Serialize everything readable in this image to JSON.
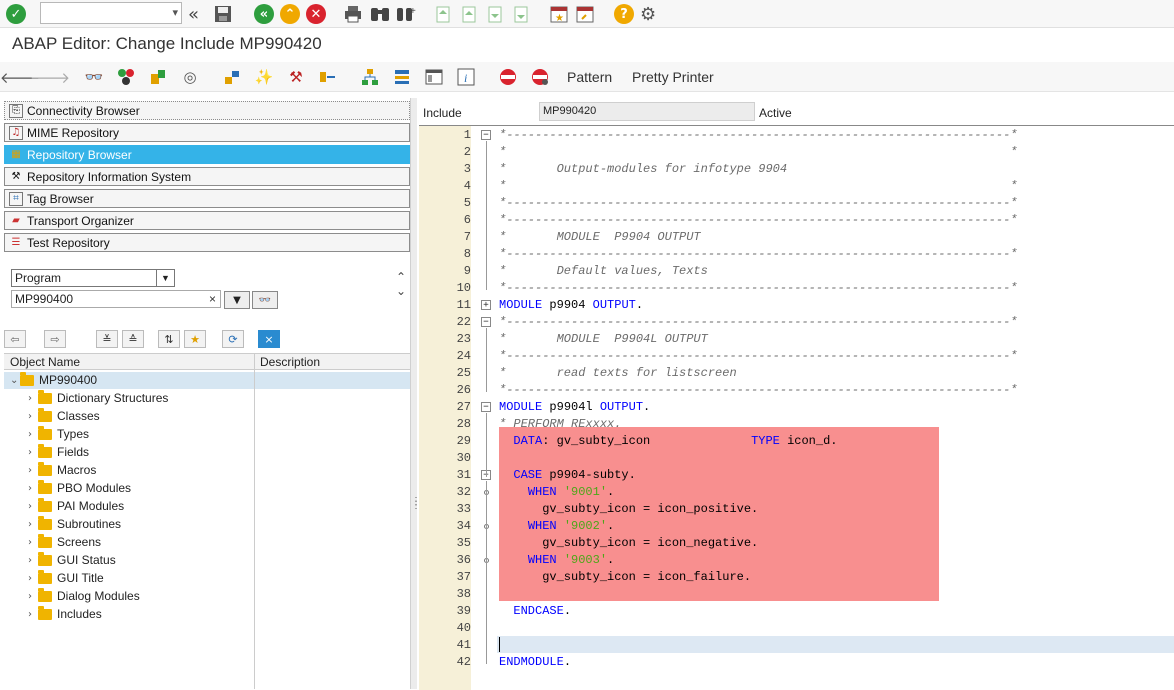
{
  "title": "ABAP Editor: Change Include MP990420",
  "systoolbar": {
    "command_field": "",
    "icons": [
      "check-icon",
      "back-icon",
      "save-icon",
      "enter-icon",
      "exit-icon",
      "cancel-icon",
      "print-icon",
      "find-icon",
      "find-next-icon",
      "first-page-icon",
      "previous-page-icon",
      "next-page-icon",
      "last-page-icon",
      "create-session-icon",
      "shortcut-icon",
      "help-icon",
      "settings-icon"
    ]
  },
  "apptoolbar": {
    "pattern_label": "Pattern",
    "pretty_printer_label": "Pretty Printer"
  },
  "navigator": {
    "buttons": [
      {
        "label": "Connectivity Browser"
      },
      {
        "label": "MIME Repository"
      },
      {
        "label": "Repository Browser"
      },
      {
        "label": "Repository Information System"
      },
      {
        "label": "Tag Browser"
      },
      {
        "label": "Transport Organizer"
      },
      {
        "label": "Test Repository"
      }
    ],
    "object_type": "Program",
    "object_name": "MP990400",
    "columns": {
      "name": "Object Name",
      "description": "Description"
    },
    "root": "MP990400",
    "nodes": [
      "Dictionary Structures",
      "Classes",
      "Types",
      "Fields",
      "Macros",
      "PBO Modules",
      "PAI Modules",
      "Subroutines",
      "Screens",
      "GUI Status",
      "GUI Title",
      "Dialog Modules",
      "Includes"
    ]
  },
  "editor": {
    "include_label": "Include",
    "include_name": "MP990420",
    "status": "Active",
    "lines": [
      {
        "n": "1",
        "t": "*----------------------------------------------------------------------*"
      },
      {
        "n": "2",
        "t": "*                                                                      *"
      },
      {
        "n": "3",
        "t": "*       Output-modules for infotype 9904"
      },
      {
        "n": "4",
        "t": "*                                                                      *"
      },
      {
        "n": "5",
        "t": "*----------------------------------------------------------------------*"
      },
      {
        "n": "6",
        "t": "*----------------------------------------------------------------------*"
      },
      {
        "n": "7",
        "t": "*       MODULE  P9904 OUTPUT"
      },
      {
        "n": "8",
        "t": "*----------------------------------------------------------------------*"
      },
      {
        "n": "9",
        "t": "*       Default values, Texts"
      },
      {
        "n": "10",
        "t": "*----------------------------------------------------------------------*"
      },
      {
        "n": "11",
        "t": "MODULE p9904 OUTPUT."
      },
      {
        "n": "22",
        "t": "*----------------------------------------------------------------------*"
      },
      {
        "n": "23",
        "t": "*       MODULE  P9904L OUTPUT"
      },
      {
        "n": "24",
        "t": "*----------------------------------------------------------------------*"
      },
      {
        "n": "25",
        "t": "*       read texts for listscreen"
      },
      {
        "n": "26",
        "t": "*----------------------------------------------------------------------*"
      },
      {
        "n": "27",
        "t": "MODULE p9904l OUTPUT."
      },
      {
        "n": "28",
        "t": "* PERFORM RExxxx."
      },
      {
        "n": "29",
        "t": "  DATA: gv_subty_icon              TYPE icon_d."
      },
      {
        "n": "30",
        "t": ""
      },
      {
        "n": "31",
        "t": "  CASE p9904-subty."
      },
      {
        "n": "32",
        "t": "    WHEN '9001'."
      },
      {
        "n": "33",
        "t": "      gv_subty_icon = icon_positive."
      },
      {
        "n": "34",
        "t": "    WHEN '9002'."
      },
      {
        "n": "35",
        "t": "      gv_subty_icon = icon_negative."
      },
      {
        "n": "36",
        "t": "    WHEN '9003'."
      },
      {
        "n": "37",
        "t": "      gv_subty_icon = icon_failure."
      },
      {
        "n": "38",
        "t": ""
      },
      {
        "n": "39",
        "t": "  ENDCASE."
      },
      {
        "n": "40",
        "t": ""
      },
      {
        "n": "41",
        "t": ""
      },
      {
        "n": "42",
        "t": "ENDMODULE."
      }
    ]
  }
}
